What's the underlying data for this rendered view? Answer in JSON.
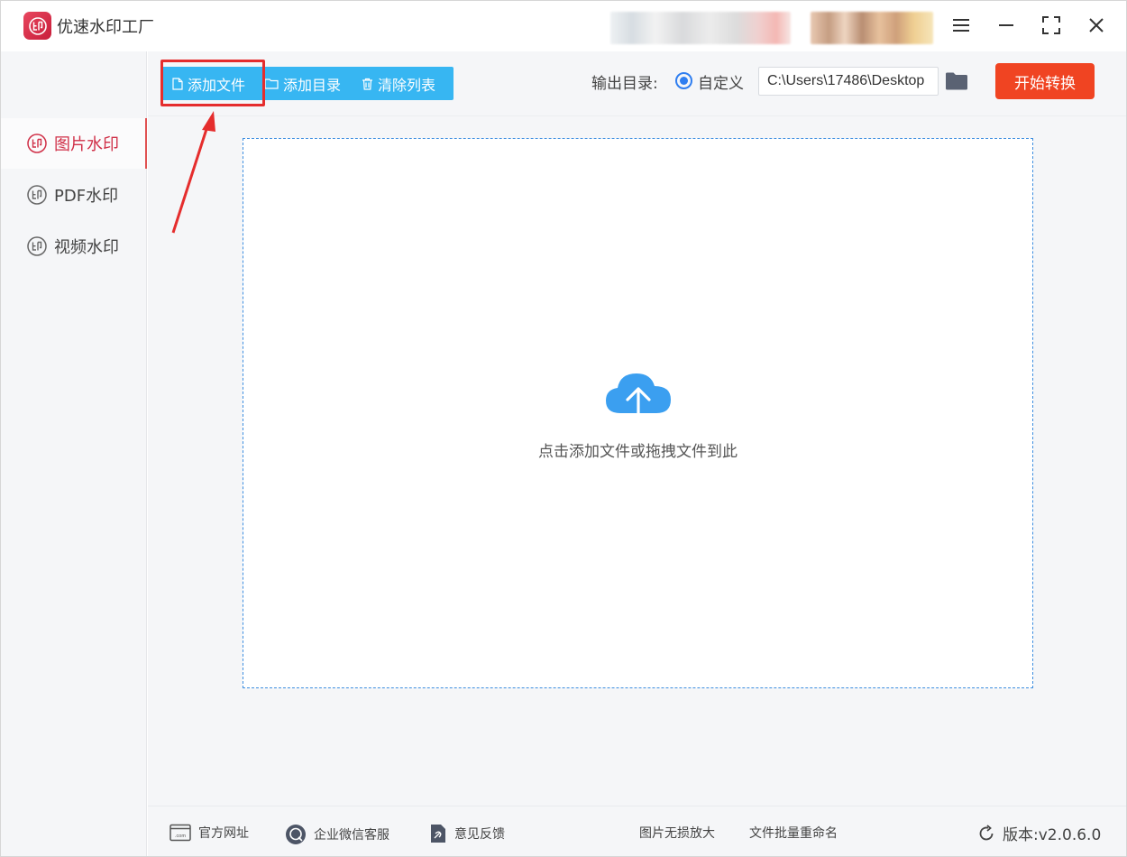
{
  "app": {
    "title": "优速水印工厂"
  },
  "sidebar": {
    "items": [
      {
        "label": "图片水印",
        "active": true
      },
      {
        "label": "PDF水印",
        "active": false
      },
      {
        "label": "视频水印",
        "active": false
      }
    ]
  },
  "toolbar": {
    "add_file": "添加文件",
    "add_dir": "添加目录",
    "clear_list": "清除列表",
    "output_label": "输出目录:",
    "custom_label": "自定义",
    "output_path": "C:\\Users\\17486\\Desktop",
    "start": "开始转换"
  },
  "main": {
    "drop_hint": "点击添加文件或拖拽文件到此"
  },
  "footer": {
    "site": "官方网址",
    "wechat": "企业微信客服",
    "feedback": "意见反馈",
    "upscale": "图片无损放大",
    "rename": "文件批量重命名",
    "version": "版本:v2.0.6.0"
  },
  "colors": {
    "accent_blue": "#37b6f2",
    "start_orange": "#f04422",
    "active_red": "#d03048",
    "annotation_red": "#e52d2d"
  },
  "icons": [
    "app-logo-icon",
    "menu-icon",
    "minimize-icon",
    "maximize-icon",
    "close-icon",
    "stamp-icon",
    "file-icon",
    "folder-icon",
    "trash-icon",
    "cloud-upload-icon",
    "web-icon",
    "chat-icon",
    "feedback-icon",
    "refresh-icon"
  ]
}
